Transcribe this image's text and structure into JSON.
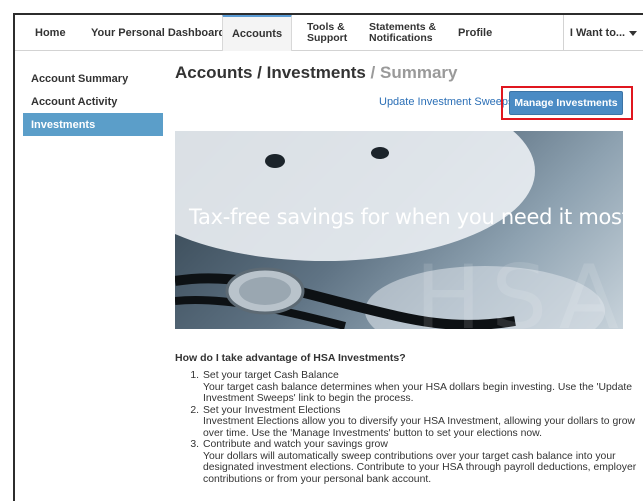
{
  "nav": {
    "items": [
      {
        "label": "Home"
      },
      {
        "label": "Your Personal Dashboard"
      },
      {
        "label": "Accounts"
      },
      {
        "label": "Tools &",
        "label2": "Support"
      },
      {
        "label": "Statements &",
        "label2": "Notifications"
      },
      {
        "label": "Profile"
      }
    ],
    "want": "I Want to..."
  },
  "sidebar": {
    "items": [
      {
        "label": "Account Summary"
      },
      {
        "label": "Account Activity"
      },
      {
        "label": "Investments"
      }
    ]
  },
  "page": {
    "title_main": "Accounts / Investments",
    "title_sep": " / ",
    "title_muted": "Summary",
    "sweeps_link": "Update Investment Sweeps",
    "manage_button": "Manage Investments"
  },
  "banner": {
    "headline": "Tax-free savings for when you need it most.",
    "watermark": "HSA"
  },
  "content": {
    "question": "How do I take advantage of HSA Investments?",
    "steps": [
      {
        "num": "1.",
        "title": "Set your target Cash Balance",
        "text": "Your target cash balance determines when your HSA dollars begin investing. Use the 'Update Investment Sweeps' link to begin the process."
      },
      {
        "num": "2.",
        "title": "Set your Investment Elections",
        "text": "Investment Elections allow you to diversify your HSA Investment, allowing your dollars to grow over time. Use the 'Manage Investments' button to set your elections now."
      },
      {
        "num": "3.",
        "title": "Contribute and watch your savings grow",
        "text": "Your dollars will automatically sweep contributions over your target cash balance into your designated investment elections. Contribute to your HSA through payroll deductions, employer contributions or from your personal bank account."
      }
    ]
  }
}
